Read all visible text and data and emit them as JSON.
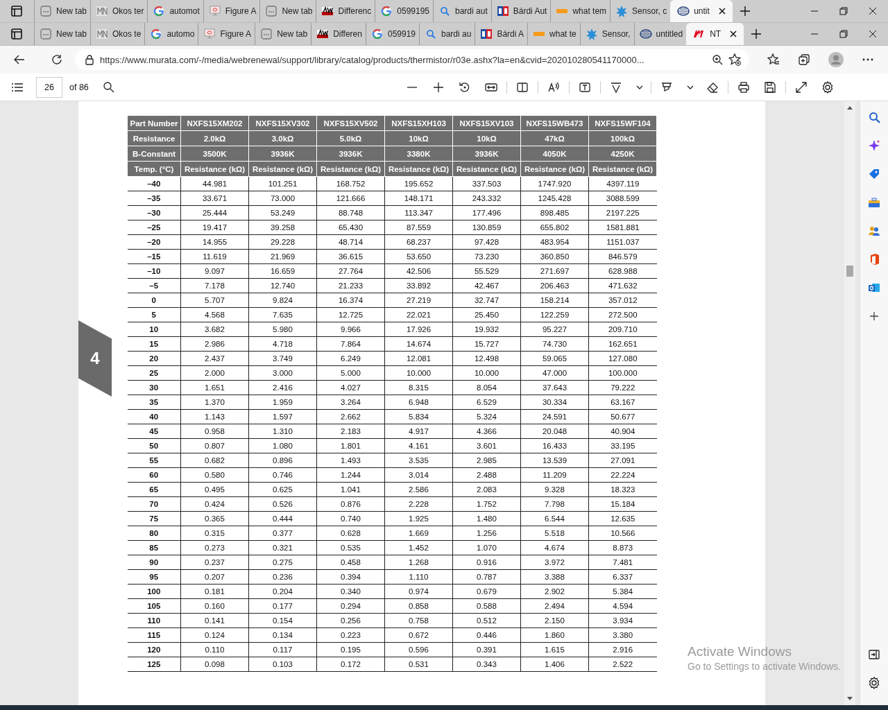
{
  "browser": {
    "tab_rows": [
      [
        {
          "label": "New tab",
          "kind": "page",
          "selected": false
        },
        {
          "label": "Okos ter",
          "kind": "mn",
          "selected": false
        },
        {
          "label": "automot",
          "kind": "google",
          "selected": false
        },
        {
          "label": "Figure A",
          "kind": "slide",
          "selected": false
        },
        {
          "label": "New tab",
          "kind": "page",
          "selected": false
        },
        {
          "label": "Differenc",
          "kind": "aw",
          "selected": false
        },
        {
          "label": "0599195",
          "kind": "google",
          "selected": false
        },
        {
          "label": "bardi aut",
          "kind": "search",
          "selected": false
        },
        {
          "label": "Bárdi Aut",
          "kind": "ba",
          "selected": false
        },
        {
          "label": "what tem",
          "kind": "aon",
          "selected": false
        },
        {
          "label": "Sensor, c",
          "kind": "star",
          "selected": false
        },
        {
          "label": "untit",
          "kind": "globe",
          "selected": true
        }
      ],
      [
        {
          "label": "New tab",
          "kind": "page",
          "selected": false
        },
        {
          "label": "Okos te",
          "kind": "mn",
          "selected": false
        },
        {
          "label": "automo",
          "kind": "google",
          "selected": false
        },
        {
          "label": "Figure A",
          "kind": "slide",
          "selected": false
        },
        {
          "label": "New tab",
          "kind": "page",
          "selected": false
        },
        {
          "label": "Differen",
          "kind": "aw",
          "selected": false
        },
        {
          "label": "059919",
          "kind": "google",
          "selected": false
        },
        {
          "label": "bardi au",
          "kind": "search",
          "selected": false
        },
        {
          "label": "Bárdi A",
          "kind": "ba",
          "selected": false
        },
        {
          "label": "what te",
          "kind": "aon",
          "selected": false
        },
        {
          "label": "Sensor,",
          "kind": "star",
          "selected": false
        },
        {
          "label": "untitled",
          "kind": "globe",
          "selected": false
        },
        {
          "label": "NT",
          "kind": "m",
          "selected": true
        }
      ]
    ],
    "address_bar": {
      "url": "https://www.murata.com/-/media/webrenewal/support/library/catalog/products/thermistor/r03e.ashx?la=en&cvid=202010280541170000..."
    }
  },
  "pdf_toolbar": {
    "page": "26",
    "page_count": "of 86"
  },
  "document": {
    "side_tab": "4",
    "table": {
      "header_rows": [
        [
          "Part Number",
          "NXFS15XM202",
          "NXFS15XV302",
          "NXFS15XV502",
          "NXFS15XH103",
          "NXFS15XV103",
          "NXFS15WB473",
          "NXFS15WF104"
        ],
        [
          "Resistance",
          "2.0kΩ",
          "3.0kΩ",
          "5.0kΩ",
          "10kΩ",
          "10kΩ",
          "47kΩ",
          "100kΩ"
        ],
        [
          "B-Constant",
          "3500K",
          "3936K",
          "3936K",
          "3380K",
          "3936K",
          "4050K",
          "4250K"
        ],
        [
          "Temp. (°C)",
          "Resistance (kΩ)",
          "Resistance (kΩ)",
          "Resistance (kΩ)",
          "Resistance (kΩ)",
          "Resistance (kΩ)",
          "Resistance (kΩ)",
          "Resistance (kΩ)"
        ]
      ],
      "rows": [
        [
          "–40",
          "44.981",
          "101.251",
          "168.752",
          "195.652",
          "337.503",
          "1747.920",
          "4397.119"
        ],
        [
          "–35",
          "33.671",
          "73.000",
          "121.666",
          "148.171",
          "243.332",
          "1245.428",
          "3088.599"
        ],
        [
          "–30",
          "25.444",
          "53.249",
          "88.748",
          "113.347",
          "177.496",
          "898.485",
          "2197.225"
        ],
        [
          "–25",
          "19.417",
          "39.258",
          "65.430",
          "87.559",
          "130.859",
          "655.802",
          "1581.881"
        ],
        [
          "–20",
          "14.955",
          "29.228",
          "48.714",
          "68.237",
          "97.428",
          "483.954",
          "1151.037"
        ],
        [
          "–15",
          "11.619",
          "21.969",
          "36.615",
          "53.650",
          "73.230",
          "360.850",
          "846.579"
        ],
        [
          "–10",
          "9.097",
          "16.659",
          "27.764",
          "42.506",
          "55.529",
          "271.697",
          "628.988"
        ],
        [
          "–5",
          "7.178",
          "12.740",
          "21.233",
          "33.892",
          "42.467",
          "206.463",
          "471.632"
        ],
        [
          "0",
          "5.707",
          "9.824",
          "16.374",
          "27.219",
          "32.747",
          "158.214",
          "357.012"
        ],
        [
          "5",
          "4.568",
          "7.635",
          "12.725",
          "22.021",
          "25.450",
          "122.259",
          "272.500"
        ],
        [
          "10",
          "3.682",
          "5.980",
          "9.966",
          "17.926",
          "19.932",
          "95.227",
          "209.710"
        ],
        [
          "15",
          "2.986",
          "4.718",
          "7.864",
          "14.674",
          "15.727",
          "74.730",
          "162.651"
        ],
        [
          "20",
          "2.437",
          "3.749",
          "6.249",
          "12.081",
          "12.498",
          "59.065",
          "127.080"
        ],
        [
          "25",
          "2.000",
          "3.000",
          "5.000",
          "10.000",
          "10.000",
          "47.000",
          "100.000"
        ],
        [
          "30",
          "1.651",
          "2.416",
          "4.027",
          "8.315",
          "8.054",
          "37.643",
          "79.222"
        ],
        [
          "35",
          "1.370",
          "1.959",
          "3.264",
          "6.948",
          "6.529",
          "30.334",
          "63.167"
        ],
        [
          "40",
          "1.143",
          "1.597",
          "2.662",
          "5.834",
          "5.324",
          "24.591",
          "50.677"
        ],
        [
          "45",
          "0.958",
          "1.310",
          "2.183",
          "4.917",
          "4.366",
          "20.048",
          "40.904"
        ],
        [
          "50",
          "0.807",
          "1.080",
          "1.801",
          "4.161",
          "3.601",
          "16.433",
          "33.195"
        ],
        [
          "55",
          "0.682",
          "0.896",
          "1.493",
          "3.535",
          "2.985",
          "13.539",
          "27.091"
        ],
        [
          "60",
          "0.580",
          "0.746",
          "1.244",
          "3.014",
          "2.488",
          "11.209",
          "22.224"
        ],
        [
          "65",
          "0.495",
          "0.625",
          "1.041",
          "2.586",
          "2.083",
          "9.328",
          "18.323"
        ],
        [
          "70",
          "0.424",
          "0.526",
          "0.876",
          "2.228",
          "1.752",
          "7.798",
          "15.184"
        ],
        [
          "75",
          "0.365",
          "0.444",
          "0.740",
          "1.925",
          "1.480",
          "6.544",
          "12.635"
        ],
        [
          "80",
          "0.315",
          "0.377",
          "0.628",
          "1.669",
          "1.256",
          "5.518",
          "10.566"
        ],
        [
          "85",
          "0.273",
          "0.321",
          "0.535",
          "1.452",
          "1.070",
          "4.674",
          "8.873"
        ],
        [
          "90",
          "0.237",
          "0.275",
          "0.458",
          "1.268",
          "0.916",
          "3.972",
          "7.481"
        ],
        [
          "95",
          "0.207",
          "0.236",
          "0.394",
          "1.110",
          "0.787",
          "3.388",
          "6.337"
        ],
        [
          "100",
          "0.181",
          "0.204",
          "0.340",
          "0.974",
          "0.679",
          "2.902",
          "5.384"
        ],
        [
          "105",
          "0.160",
          "0.177",
          "0.294",
          "0.858",
          "0.588",
          "2.494",
          "4.594"
        ],
        [
          "110",
          "0.141",
          "0.154",
          "0.256",
          "0.758",
          "0.512",
          "2.150",
          "3.934"
        ],
        [
          "115",
          "0.124",
          "0.134",
          "0.223",
          "0.672",
          "0.446",
          "1.860",
          "3.380"
        ],
        [
          "120",
          "0.110",
          "0.117",
          "0.195",
          "0.596",
          "0.391",
          "1.615",
          "2.916"
        ],
        [
          "125",
          "0.098",
          "0.103",
          "0.172",
          "0.531",
          "0.343",
          "1.406",
          "2.522"
        ]
      ]
    }
  },
  "os_overlay": {
    "title": "Activate Windows",
    "hint": "Go to Settings to activate Windows."
  }
}
